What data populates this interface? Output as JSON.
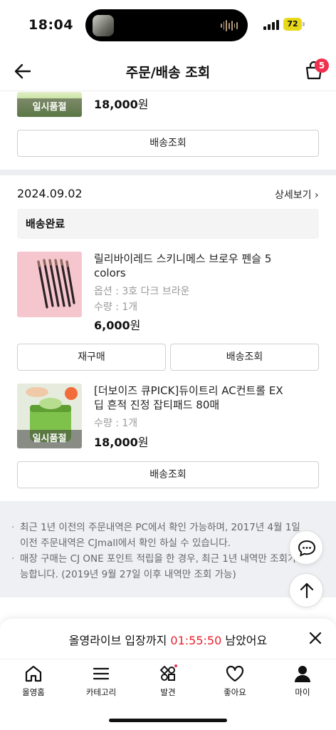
{
  "status_bar": {
    "time": "18:04",
    "battery": "72"
  },
  "header": {
    "title": "주문/배송 조회",
    "cart_count": "5"
  },
  "top_item": {
    "sold_out_label": "일시품절",
    "price": "18,000",
    "currency": "원",
    "button_label": "배송조회"
  },
  "order": {
    "date": "2024.09.02",
    "detail_label": "상세보기 ›",
    "status": "배송완료",
    "items": [
      {
        "name": "릴리바이레드 스키니메스 브로우 펜슬 5 colors",
        "option": "옵션 : 3호 다크 브라운",
        "quantity": "수량 : 1개",
        "price": "6,000",
        "currency": "원",
        "buttons": [
          "재구매",
          "배송조회"
        ]
      },
      {
        "name": "[더보이즈 큐PICK]듀이트리 AC컨트롤 EX 딥 흔적 진정 잡티패드 80매",
        "quantity": "수량 : 1개",
        "price": "18,000",
        "currency": "원",
        "sold_out_label": "일시품절",
        "buttons": [
          "배송조회"
        ]
      }
    ]
  },
  "notice": [
    "최근 1년 이전의 주문내역은 PC에서 확인 가능하며, 2017년 4월 1일 이전 주문내역은 CJmall에서 확인 하실 수 있습니다.",
    "매장 구매는 CJ ONE 포인트 적립을 한 경우, 최근 1년 내역만 조회가 가능합니다. (2019년 9월 27일 이후 내역만 조회 가능)"
  ],
  "live_banner": {
    "prefix": "올영라이브 입장까지 ",
    "timer": "01:55:50",
    "suffix": " 남았어요"
  },
  "tabs": [
    {
      "label": "올영홈",
      "icon": "home-icon"
    },
    {
      "label": "카테고리",
      "icon": "menu-icon"
    },
    {
      "label": "발견",
      "icon": "discover-icon"
    },
    {
      "label": "좋아요",
      "icon": "heart-icon"
    },
    {
      "label": "마이",
      "icon": "person-icon"
    }
  ],
  "colors": {
    "accent": "#f0304e",
    "timer": "#e8202b",
    "divider": "#eceef1"
  }
}
